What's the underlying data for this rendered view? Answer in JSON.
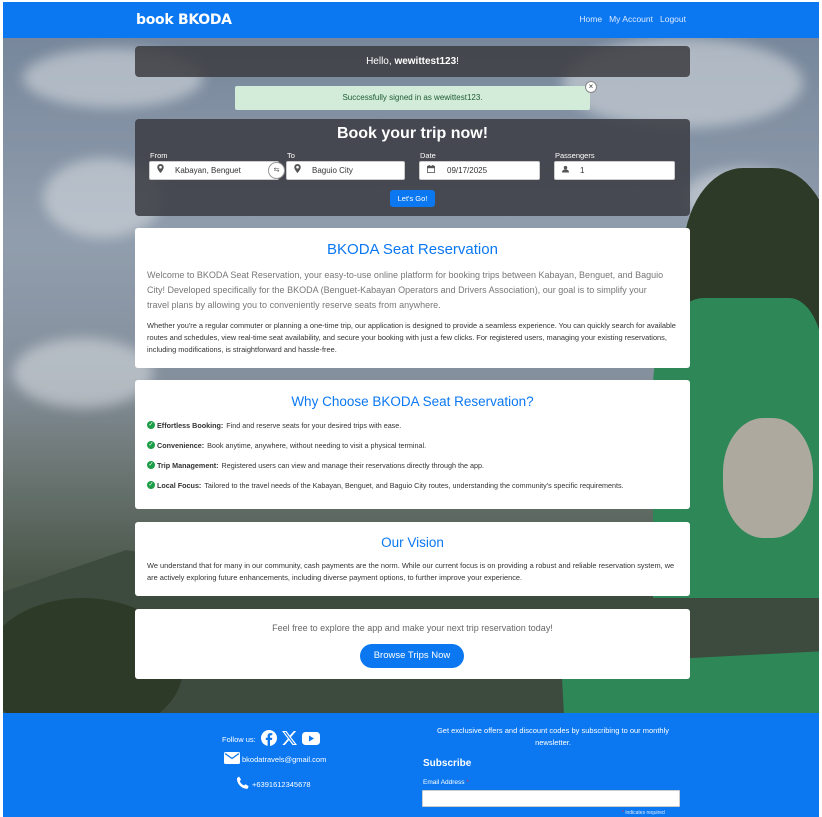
{
  "navbar": {
    "brand_prefix": "book",
    "brand_name": "BKODA",
    "links": [
      "Home",
      "My Account",
      "Logout"
    ]
  },
  "greeting": {
    "prefix": "Hello, ",
    "username": "wewittest123",
    "suffix": "!"
  },
  "alert": {
    "message": "Successfully signed in as wewittest123.",
    "close_symbol": "×"
  },
  "booking": {
    "title": "Book your trip now!",
    "from_label": "From",
    "from_value": "Kabayan, Benguet",
    "to_label": "To",
    "to_value": "Baguio City",
    "date_label": "Date",
    "date_value": "09/17/2025",
    "passengers_label": "Passengers",
    "passengers_value": "1",
    "submit_label": "Let's Go!"
  },
  "about": {
    "title": "BKODA Seat Reservation",
    "lead": "Welcome to BKODA Seat Reservation, your easy-to-use online platform for booking trips between Kabayan, Benguet, and Baguio City! Developed specifically for the BKODA (Benguet-Kabayan Operators and Drivers Association), our goal is to simplify your travel plans by allowing you to conveniently reserve seats from anywhere.",
    "body": "Whether you're a regular commuter or planning a one-time trip, our application is designed to provide a seamless experience. You can quickly search for available routes and schedules, view real-time seat availability, and secure your booking with just a few clicks. For registered users, managing your existing reservations, including modifications, is straightforward and hassle-free."
  },
  "why": {
    "title": "Why Choose BKODA Seat Reservation?",
    "items": [
      {
        "label": "Effortless Booking:",
        "text": "Find and reserve seats for your desired trips with ease."
      },
      {
        "label": "Convenience:",
        "text": "Book anytime, anywhere, without needing to visit a physical terminal."
      },
      {
        "label": "Trip Management:",
        "text": "Registered users can view and manage their reservations directly through the app."
      },
      {
        "label": "Local Focus:",
        "text": "Tailored to the travel needs of the Kabayan, Benguet, and Baguio City routes, understanding the community's specific requirements."
      }
    ]
  },
  "vision": {
    "title": "Our Vision",
    "text": "We understand that for many in our community, cash payments are the norm. While our current focus is on providing a robust and reliable reservation system, we are actively exploring future enhancements, including diverse payment options, to further improve your experience."
  },
  "cta": {
    "text": "Feel free to explore the app and make your next trip reservation today!",
    "button_label": "Browse Trips Now"
  },
  "footer": {
    "follow_label": "Follow us:",
    "email": "bkodatravels@gmail.com",
    "phone": "+6391612345678",
    "newsletter_text": "Get exclusive offers and discount codes by subscribing to our monthly newsletter.",
    "subscribe_title": "Subscribe",
    "email_label": "Email Address",
    "required_mark": "*",
    "required_note": "indicates required"
  },
  "colors": {
    "primary": "#0b78f2",
    "success_bg": "#d3ecd9",
    "check_green": "#1e9e48"
  },
  "icons": [
    "map-marker-icon",
    "swap-icon",
    "calendar-icon",
    "user-icon",
    "check-circle-icon",
    "facebook-icon",
    "x-icon",
    "youtube-icon",
    "envelope-icon",
    "phone-icon",
    "close-icon"
  ]
}
